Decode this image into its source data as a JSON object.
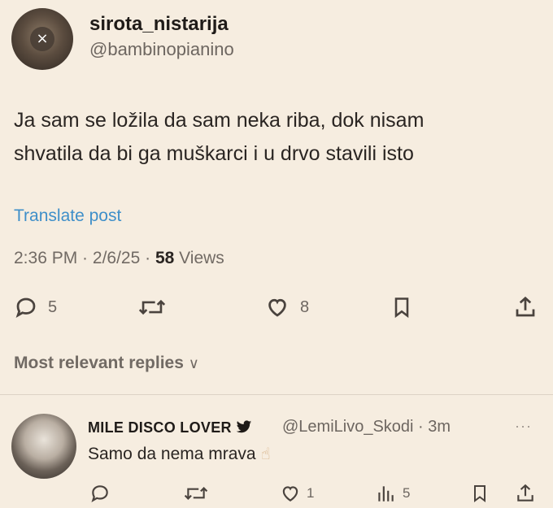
{
  "tweet": {
    "display_name": "sirota_nistarija",
    "handle": "@bambinopianino",
    "text_line1": "Ja sam se ložila da sam neka riba, dok nisam",
    "text_line2": "shvatila da bi ga muškarci i u drvo stavili isto",
    "translate_label": "Translate post",
    "time": "2:36 PM",
    "date": "2/6/25",
    "views_count": "58",
    "views_label": "Views",
    "replies_count": "5",
    "likes_count": "8",
    "avatar_close_glyph": "×"
  },
  "replies_section": {
    "heading": "Most relevant replies",
    "chevron": "∨"
  },
  "reply": {
    "display_name": "MILE DISCO LOVER",
    "handle": "@LemiLivo_Skodi",
    "age": "3m",
    "text": "Samo da nema mrava",
    "emoji": "☝",
    "more": "···",
    "likes_count": "1",
    "views_count": "5"
  },
  "icons": {
    "reply": "reply-icon",
    "retweet": "retweet-icon",
    "like": "heart-icon",
    "bookmark": "bookmark-icon",
    "share": "share-icon",
    "views": "views-icon",
    "bird": "bird-icon"
  }
}
